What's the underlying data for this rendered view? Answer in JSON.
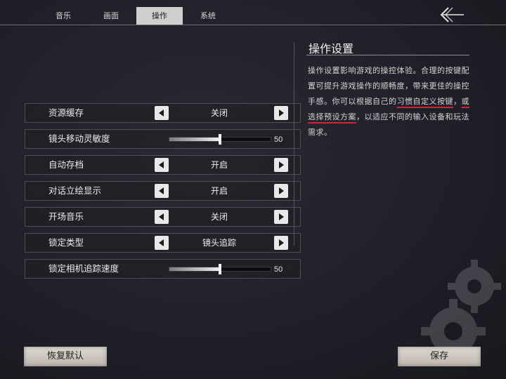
{
  "tabs": [
    {
      "label": "音乐",
      "active": false
    },
    {
      "label": "画面",
      "active": false
    },
    {
      "label": "操作",
      "active": true
    },
    {
      "label": "系统",
      "active": false
    }
  ],
  "settings": {
    "rows": [
      {
        "label": "资源缓存",
        "type": "selector",
        "value": "关闭"
      },
      {
        "label": "镜头移动灵敏度",
        "type": "slider",
        "value": "50",
        "level": 50,
        "max": 100
      },
      {
        "label": "自动存档",
        "type": "selector",
        "value": "开启"
      },
      {
        "label": "对话立绘显示",
        "type": "selector",
        "value": "开启"
      },
      {
        "label": "开场音乐",
        "type": "selector",
        "value": "关闭"
      },
      {
        "label": "锁定类型",
        "type": "selector",
        "value": "镜头追踪"
      },
      {
        "label": "锁定相机追踪速度",
        "type": "slider",
        "value": "50",
        "level": 50,
        "max": 100
      }
    ]
  },
  "info": {
    "title": "操作设置",
    "body_part1": "操作设置影响游戏的操控体验。合理的按键配置可提升游戏操作的顺畅度，带来更佳的操控手感。你可以根据自己的",
    "body_highlight1": "习惯自定义按键",
    "body_part2": "，",
    "body_highlight2": "或选择预设方案",
    "body_part3": "，以适应不同的输入设备和玩法需求。"
  },
  "buttons": {
    "reset_label": "恢复默认",
    "save_label": "保存"
  },
  "icons": {
    "back": "back-arrow-icon",
    "left": "left-arrow-icon",
    "right": "right-arrow-icon",
    "gear": "gear-icon"
  },
  "colors": {
    "highlight_underline": "#d1233a",
    "active_tab_bg": "#cfcfcf"
  }
}
